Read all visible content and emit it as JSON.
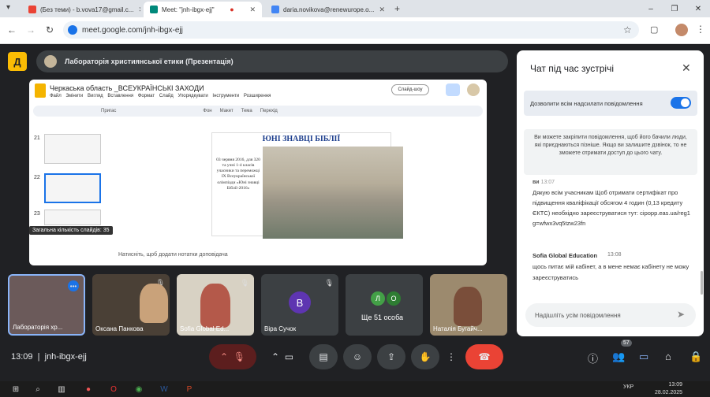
{
  "browser": {
    "tabs": [
      {
        "label": "(Без теми) - b.vova17@gmail.c..."
      },
      {
        "label": "Meet: \"jnh-ibgx-ejj\""
      },
      {
        "label": "daria.novikova@renewurope.o..."
      }
    ],
    "new_tab": "+",
    "url": "meet.google.com/jnh-ibgx-ejj"
  },
  "meet": {
    "presentation_title": "Лабораторія християнської етики (Презентація)",
    "meeting_code": "jnh-ibgx-ejj",
    "time": "13:09",
    "people_count": "57"
  },
  "slides": {
    "doc_title": "Черкаська область _ВСЕУКРАЇНСЬКІ ЗАХОДИ",
    "menu": [
      "Файл",
      "Змінити",
      "Вигляд",
      "Вставлення",
      "Формат",
      "Слайд",
      "Упорядкувати",
      "Інструменти",
      "Розширення"
    ],
    "toolbar": [
      "Пригас",
      "Фон",
      "Макет",
      "Тема",
      "Перехід"
    ],
    "share_label": "Слайд-шоу",
    "thumb_numbers": [
      "21",
      "22",
      "23"
    ],
    "slide_heading": "ЮНІ ЗНАВЦІ БІБЛІЇ",
    "slide_text": "03 червня 2016, для 320 та учні 1-4 класів учасники та переможці IX Всеукраїнської олімпіади «Юні знавці Біблії-2016»",
    "slide_count_label": "Загальна кількість слайдів: 35",
    "speaker_notes": "Натисніть, щоб додати нотатки доповідача"
  },
  "chat": {
    "title": "Чат під час зустрічі",
    "allow_label": "Дозволити всім надсилати повідомлення",
    "pin_note": "Ви можете закріпити повідомлення, щоб його бачили люди, які приєднаються пізніше. Якщо ви залишите дзвінок, то не зможете отримати доступ до цього чату.",
    "msg1_sender": "ви",
    "msg1_time": "13:07",
    "msg1_text": "Дякую всім учасникам Щоб отримати сертифікат про підвищення кваліфікації обсягом 4 годин (0,13 кредиту ЄКТС) необхідно зареєструватися тут: cipopp.eas.ua/reg1 g=wfwx3vq5tzw23fn",
    "msg2_sender": "Sofia Global Education",
    "msg2_time": "13:08",
    "msg2_text": "щось питає мій кабінет, а в мене немає кабінету не можу зареєструватись",
    "input_placeholder": "Надішліть усім повідомлення"
  },
  "participants": [
    {
      "name": "Лабораторія хр..."
    },
    {
      "name": "Оксана Панкова"
    },
    {
      "name": "Sofia Global Ed..."
    },
    {
      "name": "Віра Сучок",
      "initial": "В"
    },
    {
      "name": "Ще 51 особа",
      "initials": [
        "Л",
        "О"
      ]
    },
    {
      "name": "Наталія Бугайч..."
    }
  ],
  "taskbar": {
    "lang": "УКР",
    "time": "13:09",
    "date": "28.02.2025"
  },
  "colors": {
    "accent": "#1a73e8",
    "end_call": "#ea4335",
    "meet_bg": "#202124",
    "logo": "#fbbc04"
  }
}
